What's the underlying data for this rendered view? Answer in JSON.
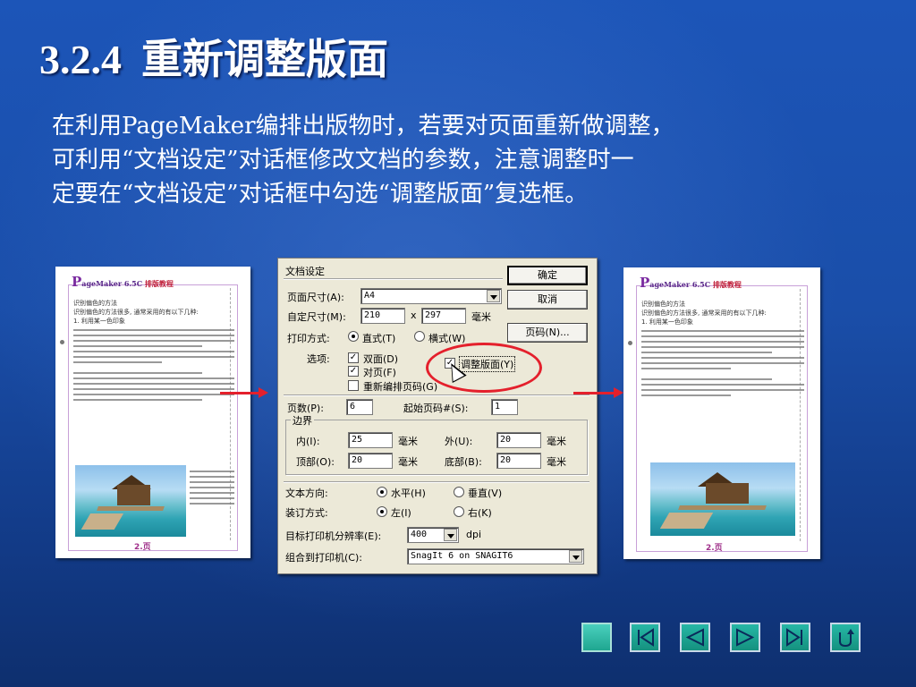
{
  "slide": {
    "section_number": "3.2.4",
    "title": "重新调整版面",
    "paragraph_lines": [
      "在利用PageMaker编排出版物时，若要对页面重新做调整，",
      "可利用“文档设定”对话框修改文档的参数，注意调整时一",
      "定要在“文档设定”对话框中勾选“调整版面”复选框。"
    ]
  },
  "thumbnail_left": {
    "header_letter": "P",
    "header_text": "ageMaker 6.5C",
    "header_red": "排版教程",
    "lines": [
      "识别偏色的方法",
      "识别偏色的方法很多, 通常采用的有以下几种:",
      "1.   利用某一色印象"
    ],
    "footer": "2.页"
  },
  "thumbnail_right": {
    "header_letter": "P",
    "header_text": "ageMaker 6.5C",
    "header_red": "排版教程",
    "lines": [
      "识别偏色的方法",
      "识别偏色的方法很多, 通常采用的有以下几种:",
      "1.   利用某一色印象"
    ],
    "footer": "2.页"
  },
  "dialog": {
    "title": "文档设定",
    "buttons": {
      "ok": "确定",
      "cancel": "取消",
      "numbers": "页码(N)..."
    },
    "page_size_label": "页面尺寸(A):",
    "page_size_value": "A4",
    "custom_size_label": "自定尺寸(M):",
    "width_value": "210",
    "x_label": "x",
    "height_value": "297",
    "unit_mm": "毫米",
    "orientation_label": "打印方式:",
    "orientation_portrait": "直式(T)",
    "orientation_landscape": "横式(W)",
    "options_label": "选项:",
    "option_double_sided": "双面(D)",
    "option_facing": "对页(F)",
    "option_renumber": "重新编排页码(G)",
    "option_adjust_layout": "调整版面(Y)",
    "pages_label": "页数(P):",
    "pages_value": "6",
    "start_page_label": "起始页码#(S):",
    "start_page_value": "1",
    "margins_group": "边界",
    "inner_label": "内(I):",
    "inner_value": "25",
    "outer_label": "外(U):",
    "outer_value": "20",
    "top_label": "顶部(O):",
    "top_value": "20",
    "bottom_label": "底部(B):",
    "bottom_value": "20",
    "text_dir_label": "文本方向:",
    "text_dir_horizontal": "水平(H)",
    "text_dir_vertical": "垂直(V)",
    "binding_label": "装订方式:",
    "binding_left": "左(I)",
    "binding_right": "右(K)",
    "resolution_label": "目标打印机分辨率(E):",
    "resolution_value": "400",
    "resolution_unit": "dpi",
    "printer_label": "组合到打印机(C):",
    "printer_value": "SnagIt 6 on SNAGIT6"
  },
  "colors": {
    "background": "#1a4ea9",
    "highlight_red": "#e4202c",
    "nav_teal": "#1fa690"
  },
  "nav_buttons": [
    "blank",
    "first",
    "previous",
    "next",
    "last",
    "return"
  ]
}
